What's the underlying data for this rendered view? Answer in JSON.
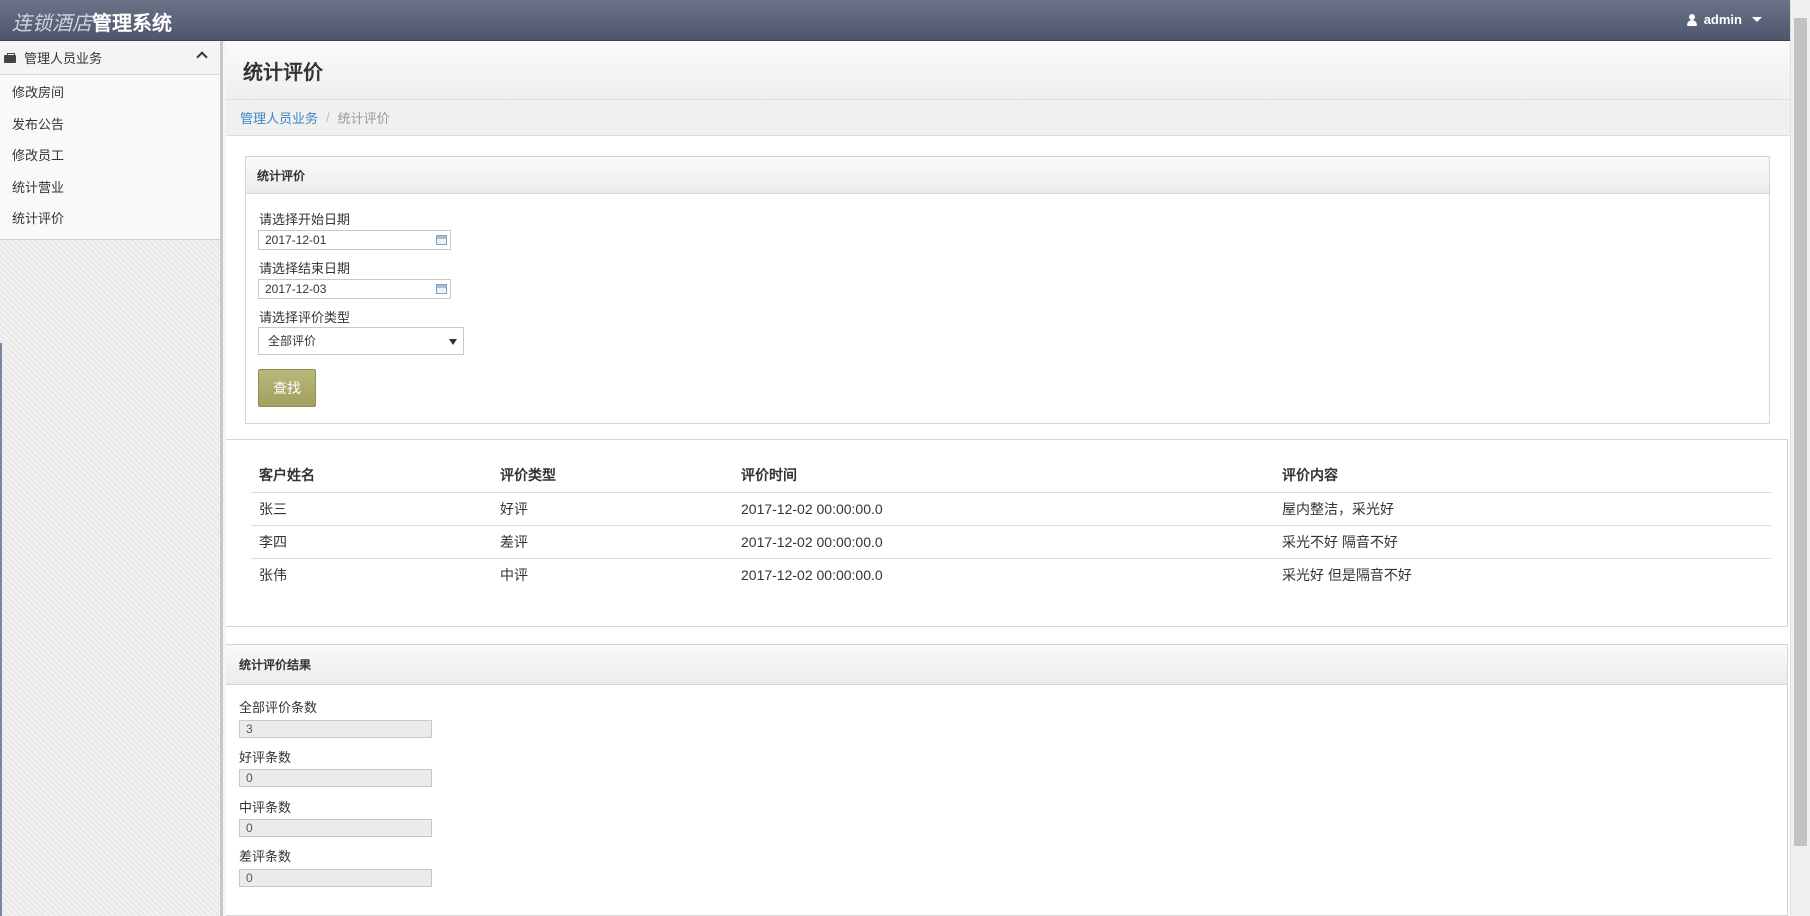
{
  "app": {
    "brand_italic": "连锁酒店",
    "brand_bold": "管理系统",
    "user": "admin"
  },
  "sidebar": {
    "header": "管理人员业务",
    "items": [
      {
        "label": "修改房间"
      },
      {
        "label": "发布公告"
      },
      {
        "label": "修改员工"
      },
      {
        "label": "统计营业"
      },
      {
        "label": "统计评价"
      }
    ]
  },
  "page": {
    "title": "统计评价",
    "breadcrumb": {
      "parent": "管理人员业务",
      "separator": "/",
      "current": "统计评价"
    }
  },
  "search": {
    "heading": "统计评价",
    "start_label": "请选择开始日期",
    "start_value": "2017-12-01",
    "end_label": "请选择结束日期",
    "end_value": "2017-12-03",
    "type_label": "请选择评价类型",
    "type_value": "全部评价",
    "button": "查找"
  },
  "table": {
    "columns": [
      "客户姓名",
      "评价类型",
      "评价时间",
      "评价内容"
    ],
    "rows": [
      [
        "张三",
        "好评",
        "2017-12-02 00:00:00.0",
        "屋内整洁，采光好"
      ],
      [
        "李四",
        "差评",
        "2017-12-02 00:00:00.0",
        "采光不好 隔音不好"
      ],
      [
        "张伟",
        "中评",
        "2017-12-02 00:00:00.0",
        "采光好 但是隔音不好"
      ]
    ]
  },
  "results": {
    "heading": "统计评价结果",
    "total_label": "全部评价条数",
    "total_value": "3",
    "good_label": "好评条数",
    "good_value": "0",
    "neutral_label": "中评条数",
    "neutral_value": "0",
    "bad_label": "差评条数",
    "bad_value": "0"
  }
}
